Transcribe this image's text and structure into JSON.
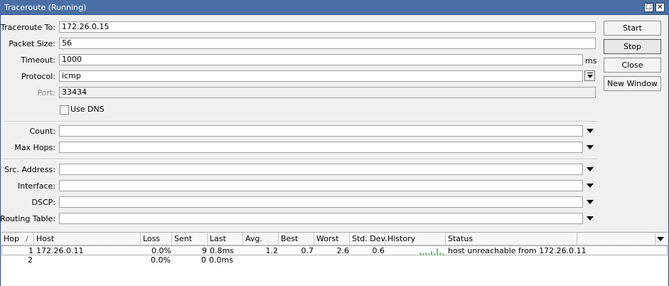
{
  "window": {
    "title": "Traceroute (Running)",
    "maximize_glyph": "☐",
    "close_glyph": "✕"
  },
  "form": {
    "traceroute_to": {
      "label": "Traceroute To:",
      "value": "172.26.0.15"
    },
    "packet_size": {
      "label": "Packet Size:",
      "value": "56"
    },
    "timeout": {
      "label": "Timeout:",
      "value": "1000",
      "unit": "ms"
    },
    "protocol": {
      "label": "Protocol:",
      "value": "icmp"
    },
    "port": {
      "label": "Port:",
      "value": "33434"
    },
    "use_dns": {
      "label": "Use DNS",
      "checked": false
    },
    "count": {
      "label": "Count:",
      "value": ""
    },
    "max_hops": {
      "label": "Max Hops:",
      "value": ""
    },
    "src_address": {
      "label": "Src. Address:",
      "value": ""
    },
    "interface": {
      "label": "Interface:",
      "value": ""
    },
    "dscp": {
      "label": "DSCP:",
      "value": ""
    },
    "routing_table": {
      "label": "Routing Table:",
      "value": ""
    }
  },
  "buttons": {
    "start": "Start",
    "stop": "Stop",
    "close": "Close",
    "new_window": "New Window"
  },
  "table": {
    "columns": [
      "Hop",
      "Host",
      "Loss",
      "Sent",
      "Last",
      "Avg.",
      "Best",
      "Worst",
      "Std. Dev.",
      "History",
      "Status"
    ],
    "sort_indicator": "/",
    "rows": [
      {
        "hop": "1",
        "host": "172.26.0.11",
        "loss": "0.0%",
        "sent": "9",
        "last": "0.8ms",
        "avg": "1.2",
        "best": "0.7",
        "worst": "2.6",
        "std_dev": "0.6",
        "history": [
          0.4,
          0.3,
          0.4,
          0.3,
          0.5,
          0.3,
          0.9,
          0.4,
          0.3
        ],
        "status": "host unreachable from 172.26.0.11"
      },
      {
        "hop": "2",
        "host": "",
        "loss": "0.0%",
        "sent": "0",
        "last": "0.0ms",
        "avg": "",
        "best": "",
        "worst": "",
        "std_dev": "",
        "history": [],
        "status": ""
      }
    ]
  },
  "colors": {
    "titlebar": "#4a6fa5",
    "history_bar": "#7fbf8f",
    "history_peak": "#3a9bd5"
  }
}
